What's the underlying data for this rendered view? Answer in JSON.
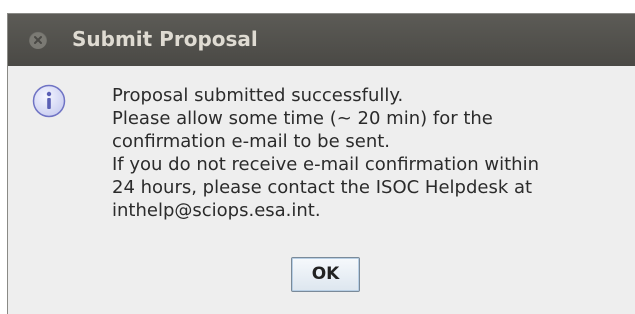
{
  "window": {
    "title": "Submit Proposal",
    "close_icon": "close-icon"
  },
  "dialog": {
    "icon": "info-icon",
    "message_lines": [
      "Proposal submitted successfully.",
      "Please allow some time (~ 20 min) for the",
      "confirmation e-mail to be sent.",
      "If you do not receive e-mail confirmation within",
      "24 hours, please contact the ISOC Helpdesk at",
      "inthelp@sciops.esa.int."
    ],
    "ok_label": "OK"
  },
  "colors": {
    "titlebar": "#4f4e49",
    "title_text": "#dfdbd2",
    "dialog_background": "#eeeeee",
    "icon_fill": "#d9dcf5",
    "icon_stroke": "#6f73c4"
  }
}
